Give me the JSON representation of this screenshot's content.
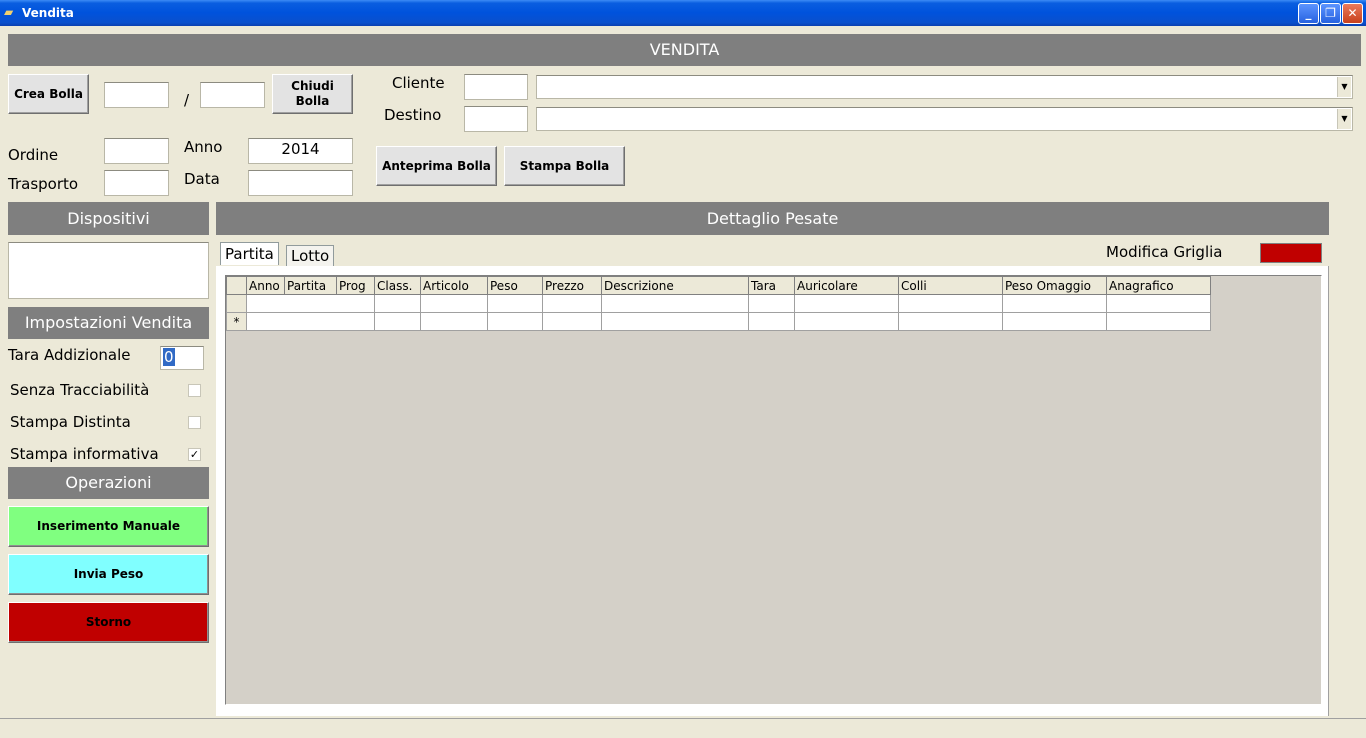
{
  "window": {
    "title": "Vendita",
    "controls": {
      "minimize": "_",
      "restore": "❐",
      "close": "✕"
    }
  },
  "header": {
    "title": "VENDITA"
  },
  "bolla": {
    "create_label": "Crea Bolla",
    "close_label": "Chiudi Bolla",
    "number_value": "",
    "separator": "/",
    "series_value": ""
  },
  "cliente": {
    "label": "Cliente",
    "code": "",
    "name": ""
  },
  "destino": {
    "label": "Destino",
    "code": "",
    "name": ""
  },
  "ordine": {
    "label": "Ordine",
    "value": ""
  },
  "trasporto": {
    "label": "Trasporto",
    "value": ""
  },
  "anno": {
    "label": "Anno",
    "value": "2014"
  },
  "data": {
    "label": "Data",
    "value": ""
  },
  "preview_label": "Anteprima Bolla",
  "print_label": "Stampa Bolla",
  "dispositivi": {
    "title": "Dispositivi"
  },
  "impostazioni": {
    "title": "Impostazioni Vendita",
    "tara_label": "Tara Addizionale",
    "tara_value": "0",
    "senza_label": "Senza Tracciabilità",
    "senza_checked": false,
    "distinta_label": "Stampa Distinta",
    "distinta_checked": false,
    "informativa_label": "Stampa informativa",
    "informativa_checked": true
  },
  "operazioni": {
    "title": "Operazioni",
    "manual_label": "Inserimento Manuale",
    "manual_color": "#80ff80",
    "send_label": "Invia Peso",
    "send_color": "#80ffff",
    "storno_label": "Storno",
    "storno_color": "#c00000"
  },
  "dettaglio": {
    "title": "Dettaglio Pesate",
    "tabs": [
      "Partita",
      "Lotto"
    ],
    "modifica_label": "Modifica Griglia",
    "modifica_color": "#c00000",
    "columns": [
      "Anno",
      "Partita",
      "Prog",
      "Class.",
      "Articolo",
      "Peso",
      "Prezzo",
      "Descrizione",
      "Tara",
      "Auricolare",
      "Colli",
      "Peso Omaggio",
      "Anagrafico"
    ],
    "new_row_marker": "*"
  }
}
